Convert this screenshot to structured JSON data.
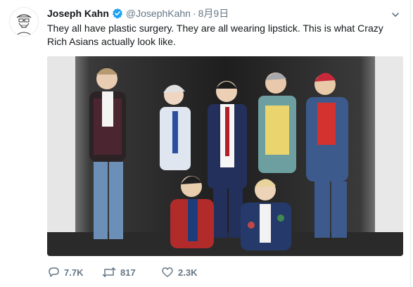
{
  "author": {
    "display_name": "Joseph Kahn",
    "handle": "@JosephKahn",
    "separator": "·",
    "date": "8月9日",
    "verified": true
  },
  "tweet": {
    "text": "They all have plastic surgery. They are all wearing lipstick. This is what Crazy Rich Asians actually look like."
  },
  "actions": {
    "reply_count": "7.7K",
    "retweet_count": "817",
    "like_count": "2.3K"
  },
  "colors": {
    "accent": "#1da1f2",
    "text": "#14171a",
    "muted": "#657786",
    "border": "#e6ecf0"
  },
  "icons": {
    "verified": "verified-badge-icon",
    "caret": "chevron-down-icon",
    "reply": "reply-icon",
    "retweet": "retweet-icon",
    "like": "heart-icon"
  }
}
